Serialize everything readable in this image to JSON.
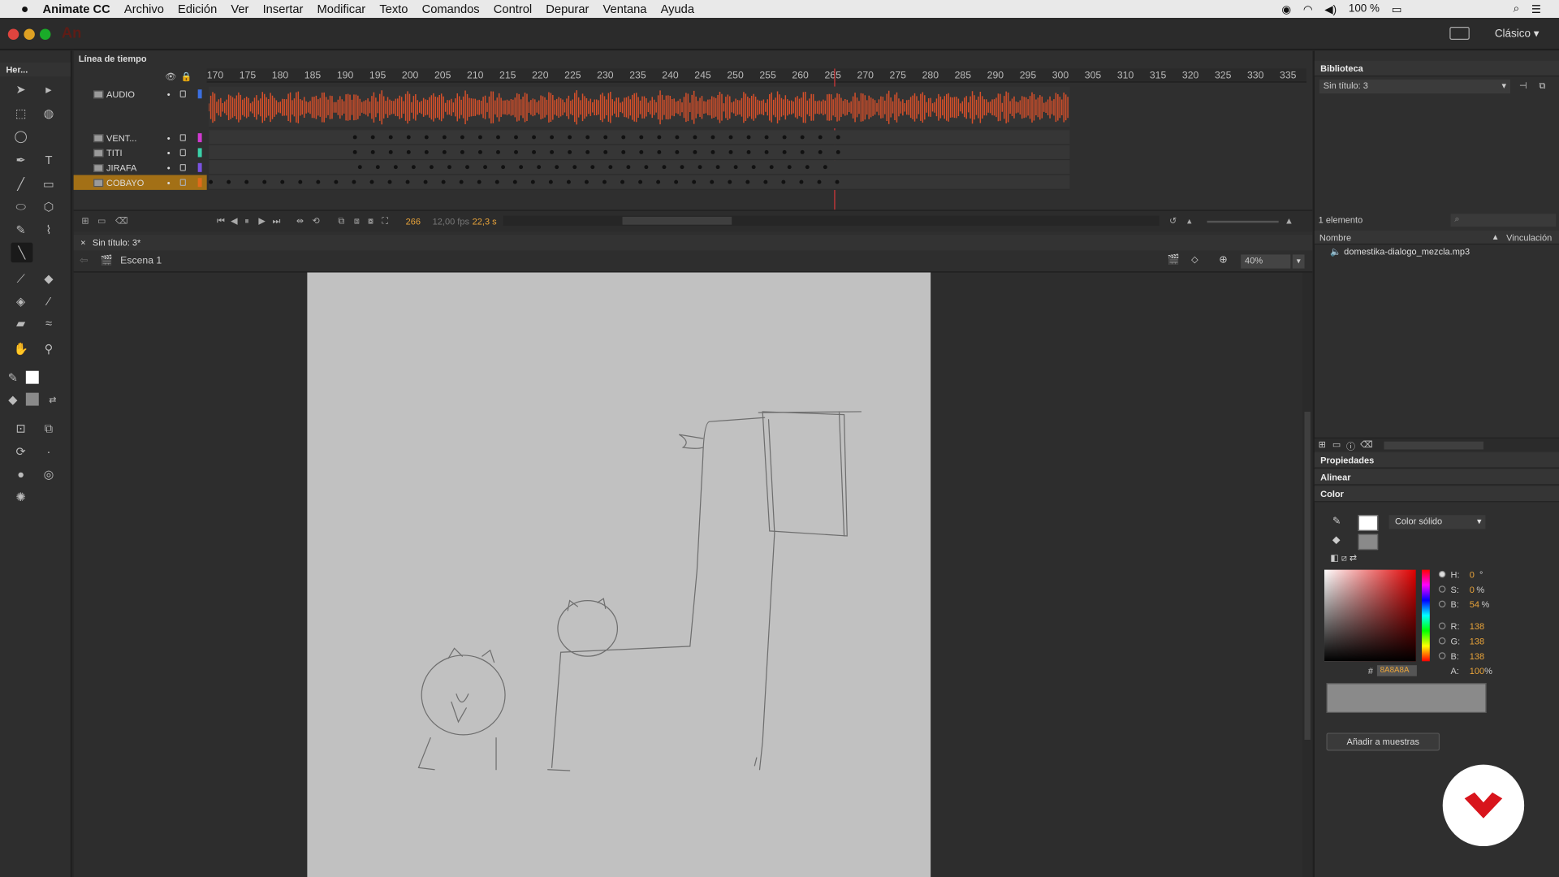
{
  "menubar": {
    "app_name": "Animate CC",
    "items": [
      "Archivo",
      "Edición",
      "Ver",
      "Insertar",
      "Modificar",
      "Texto",
      "Comandos",
      "Control",
      "Depurar",
      "Ventana",
      "Ayuda"
    ],
    "battery": "100 %"
  },
  "window": {
    "app_logo": "An",
    "workspace": "Clásico"
  },
  "tools": {
    "header": "Her..."
  },
  "timeline": {
    "title": "Línea de tiempo",
    "frame_numbers": [
      "170",
      "175",
      "180",
      "185",
      "190",
      "195",
      "200",
      "205",
      "210",
      "215",
      "220",
      "225",
      "230",
      "235",
      "240",
      "245",
      "250",
      "255",
      "260",
      "265",
      "270",
      "275",
      "280",
      "285",
      "290",
      "295",
      "300",
      "305",
      "310",
      "315",
      "320",
      "325",
      "330",
      "335"
    ],
    "layers": [
      {
        "name": "AUDIO",
        "color": "#3b6fe0"
      },
      {
        "name": "VENT...",
        "color": "#d03ad0"
      },
      {
        "name": "TITI",
        "color": "#3ad0a8"
      },
      {
        "name": "JIRAFA",
        "color": "#7a52e0"
      },
      {
        "name": "COBAYO",
        "color": "#e06a1a"
      }
    ],
    "current_frame": "266",
    "fps": "12,00 fps",
    "time": "22,3 s"
  },
  "document": {
    "tab": "Sin título: 3*",
    "scene": "Escena 1",
    "zoom": "40%"
  },
  "library": {
    "title": "Biblioteca",
    "doc_select": "Sin título: 3",
    "count": "1 elemento",
    "col_name": "Nombre",
    "col_link": "Vinculación",
    "items": [
      "domestika-dialogo_mezcla.mp3"
    ]
  },
  "panels": {
    "properties": "Propiedades",
    "align": "Alinear",
    "color": "Color"
  },
  "color": {
    "fill_type": "Color sólido",
    "h_label": "H:",
    "h": "0",
    "h_unit": "°",
    "s_label": "S:",
    "s": "0",
    "s_unit": "%",
    "b_label": "B:",
    "b": "54",
    "b_unit": "%",
    "r_label": "R:",
    "r": "138",
    "g_label": "G:",
    "g": "138",
    "bl_label": "B:",
    "bl": "138",
    "hex_label": "#",
    "hex": "8A8A8A",
    "a_label": "A:",
    "a": "100",
    "a_unit": "%",
    "add_swatch": "Añadir a muestras",
    "swatch_color": "#8a8a8a"
  }
}
